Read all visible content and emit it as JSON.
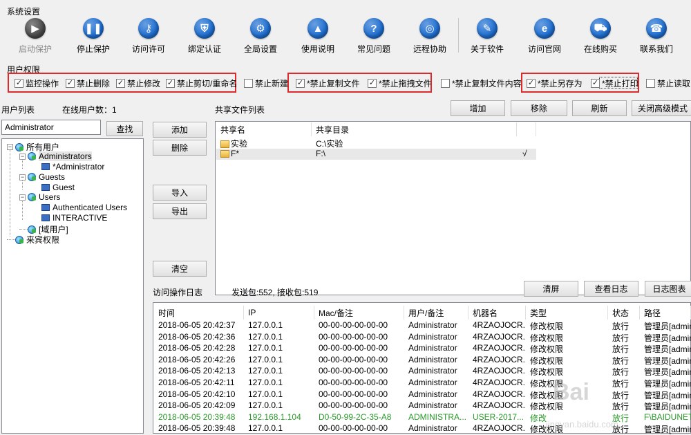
{
  "system": {
    "label": "系统设置"
  },
  "toolbar": [
    {
      "label": "启动保护",
      "icon": "play-icon",
      "glyph": "▶",
      "color": "#4a4a4a",
      "disabled": true
    },
    {
      "label": "停止保护",
      "icon": "pause-icon",
      "glyph": "❚❚",
      "color": "#1f6fd1"
    },
    {
      "label": "访问许可",
      "icon": "key-icon",
      "glyph": "⚷",
      "color": "#1f6fd1"
    },
    {
      "label": "绑定认证",
      "icon": "shield-icon",
      "glyph": "⛨",
      "color": "#1f6fd1"
    },
    {
      "label": "全局设置",
      "icon": "gear-icon",
      "glyph": "⚙",
      "color": "#1f6fd1"
    },
    {
      "label": "使用说明",
      "icon": "mortarboard-icon",
      "glyph": "▲",
      "color": "#1f6fd1"
    },
    {
      "label": "常见问题",
      "icon": "question-icon",
      "glyph": "?",
      "color": "#1f6fd1"
    },
    {
      "label": "远程协助",
      "icon": "globe-hand-icon",
      "glyph": "◎",
      "color": "#1f6fd1"
    },
    {
      "label": "关于软件",
      "icon": "notepad-icon",
      "glyph": "✎",
      "color": "#1f6fd1"
    },
    {
      "label": "访问官网",
      "icon": "browser-e-icon",
      "glyph": "e",
      "color": "#1f6fd1"
    },
    {
      "label": "在线购买",
      "icon": "cart-icon",
      "glyph": "⛟",
      "color": "#1f6fd1"
    },
    {
      "label": "联系我们",
      "icon": "phone-icon",
      "glyph": "☎",
      "color": "#1f6fd1"
    }
  ],
  "permissions": {
    "label": "用户权限",
    "items": [
      {
        "label": "监控操作",
        "checked": true
      },
      {
        "label": "禁止删除",
        "checked": true
      },
      {
        "label": "禁止修改",
        "checked": true
      },
      {
        "label": "禁止剪切/重命名",
        "checked": true
      },
      {
        "label": "禁止新建",
        "checked": false
      },
      {
        "label": "*禁止复制文件",
        "checked": true
      },
      {
        "label": "*禁止拖拽文件",
        "checked": true
      },
      {
        "label": "*禁止复制文件内容",
        "checked": false
      },
      {
        "label": "*禁止另存为",
        "checked": true
      },
      {
        "label": "*禁止打印",
        "checked": true
      },
      {
        "label": "禁止读取",
        "checked": false
      }
    ]
  },
  "users": {
    "title": "用户列表",
    "online_label": "在线用户数：1",
    "search_value": "Administrator",
    "search_button": "查找",
    "tree": [
      {
        "label": "所有用户",
        "type": "globe",
        "toggle": "−"
      },
      {
        "label": "Administrators",
        "type": "globe",
        "toggle": "−"
      },
      {
        "label": "*Administrator",
        "type": "monitor"
      },
      {
        "label": "Guests",
        "type": "globe",
        "toggle": "−"
      },
      {
        "label": "Guest",
        "type": "monitor"
      },
      {
        "label": "Users",
        "type": "globe",
        "toggle": "−"
      },
      {
        "label": "Authenticated Users",
        "type": "monitor"
      },
      {
        "label": "INTERACTIVE",
        "type": "monitor"
      },
      {
        "label": "[域用户]",
        "type": "globe"
      },
      {
        "label": "来宾权限",
        "type": "globe"
      }
    ]
  },
  "actions": {
    "add": "添加",
    "delete": "删除",
    "import": "导入",
    "export": "导出",
    "clear": "清空"
  },
  "shares": {
    "title": "共享文件列表",
    "buttons": {
      "add": "增加",
      "remove": "移除",
      "refresh": "刷新",
      "advanced": "关闭高级模式"
    },
    "columns": [
      "共享名",
      "共享目录"
    ],
    "rows": [
      {
        "name": "实验",
        "dir": "C:\\实验",
        "mark": ""
      },
      {
        "name": "F*",
        "dir": "F:\\",
        "mark": "√"
      }
    ]
  },
  "log": {
    "title": "访问操作日志",
    "stats": "发送包:552, 接收包:519",
    "buttons": {
      "clear": "清屏",
      "view": "查看日志",
      "chart": "日志图表"
    },
    "columns": [
      "时间",
      "IP",
      "Mac/备注",
      "用户/备注",
      "机器名",
      "类型",
      "状态",
      "路径"
    ],
    "rows": [
      {
        "time": "2018-06-05 20:42:37",
        "ip": "127.0.0.1",
        "mac": "00-00-00-00-00-00",
        "user": "Administrator",
        "machine": "4RZAOJOCR...",
        "type": "修改权限",
        "status": "放行",
        "path": "管理员[admin",
        "green": false
      },
      {
        "time": "2018-06-05 20:42:36",
        "ip": "127.0.0.1",
        "mac": "00-00-00-00-00-00",
        "user": "Administrator",
        "machine": "4RZAOJOCR...",
        "type": "修改权限",
        "status": "放行",
        "path": "管理员[admin",
        "green": false
      },
      {
        "time": "2018-06-05 20:42:28",
        "ip": "127.0.0.1",
        "mac": "00-00-00-00-00-00",
        "user": "Administrator",
        "machine": "4RZAOJOCR...",
        "type": "修改权限",
        "status": "放行",
        "path": "管理员[admin",
        "green": false
      },
      {
        "time": "2018-06-05 20:42:26",
        "ip": "127.0.0.1",
        "mac": "00-00-00-00-00-00",
        "user": "Administrator",
        "machine": "4RZAOJOCR...",
        "type": "修改权限",
        "status": "放行",
        "path": "管理员[admin",
        "green": false
      },
      {
        "time": "2018-06-05 20:42:13",
        "ip": "127.0.0.1",
        "mac": "00-00-00-00-00-00",
        "user": "Administrator",
        "machine": "4RZAOJOCR...",
        "type": "修改权限",
        "status": "放行",
        "path": "管理员[admin",
        "green": false
      },
      {
        "time": "2018-06-05 20:42:11",
        "ip": "127.0.0.1",
        "mac": "00-00-00-00-00-00",
        "user": "Administrator",
        "machine": "4RZAOJOCR...",
        "type": "修改权限",
        "status": "放行",
        "path": "管理员[admin",
        "green": false
      },
      {
        "time": "2018-06-05 20:42:10",
        "ip": "127.0.0.1",
        "mac": "00-00-00-00-00-00",
        "user": "Administrator",
        "machine": "4RZAOJOCR...",
        "type": "修改权限",
        "status": "放行",
        "path": "管理员[admin",
        "green": false
      },
      {
        "time": "2018-06-05 20:42:09",
        "ip": "127.0.0.1",
        "mac": "00-00-00-00-00-00",
        "user": "Administrator",
        "machine": "4RZAOJOCR...",
        "type": "修改权限",
        "status": "放行",
        "path": "管理员[admin",
        "green": false
      },
      {
        "time": "2018-06-05 20:39:48",
        "ip": "192.168.1.104",
        "mac": "D0-50-99-2C-35-A8",
        "user": "ADMINISTRA...",
        "machine": "USER-2017...",
        "type": "修改",
        "status": "放行",
        "path": "F\\BAIDUNET",
        "green": true
      },
      {
        "time": "2018-06-05 20:39:48",
        "ip": "127.0.0.1",
        "mac": "00-00-00-00-00-00",
        "user": "Administrator",
        "machine": "4RZAOJOCR...",
        "type": "修改权限",
        "status": "放行",
        "path": "管理员[admin",
        "green": false
      }
    ]
  },
  "watermark": {
    "brand": "Bai",
    "sub": "jingyan.baidu.com"
  }
}
